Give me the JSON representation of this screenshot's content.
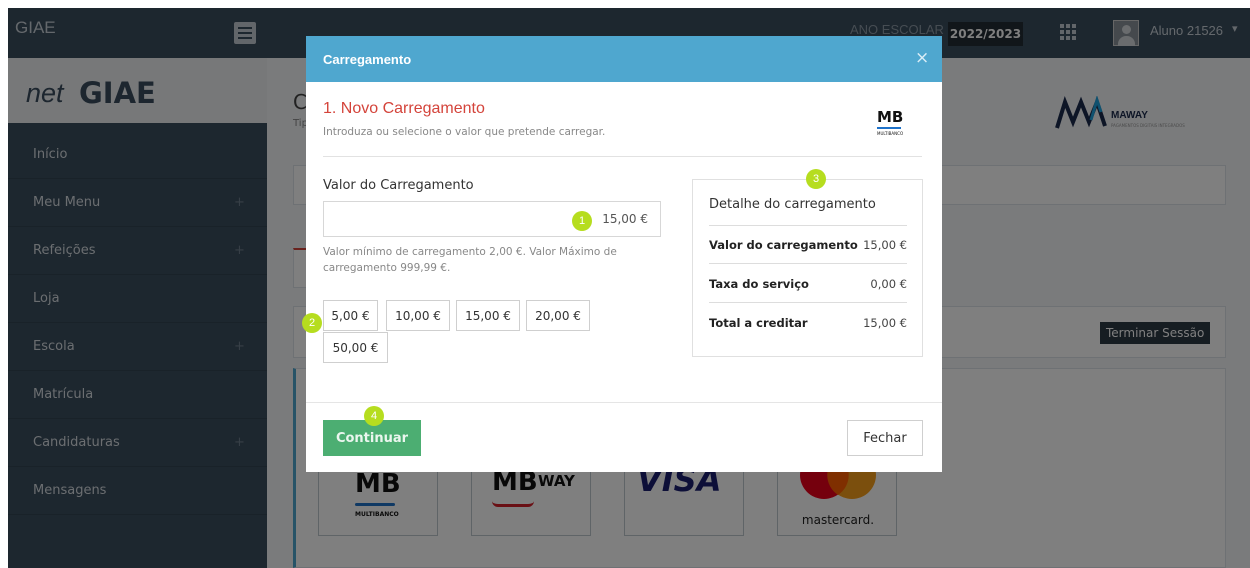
{
  "topbar": {
    "brand": "GIAE",
    "year_label": "ANO ESCOLAR",
    "year_value": "2022/2023",
    "user_name": "Aluno 21526",
    "caret": "▾"
  },
  "sidebar": {
    "logo_net": "net",
    "logo_giae": "GIAE",
    "items": [
      {
        "label": "Início",
        "expandable": false
      },
      {
        "label": "Meu Menu",
        "expandable": true
      },
      {
        "label": "Refeições",
        "expandable": true
      },
      {
        "label": "Loja",
        "expandable": false
      },
      {
        "label": "Escola",
        "expandable": true
      },
      {
        "label": "Matrícula",
        "expandable": false
      },
      {
        "label": "Candidaturas",
        "expandable": true
      },
      {
        "label": "Mensagens",
        "expandable": false
      }
    ],
    "plus": "+"
  },
  "background": {
    "title_fragment": "C",
    "sub_fragment": "Tip",
    "maway_brand": "MAWAY",
    "maway_tagline": "PAGAMENTOS DIGITAIS INTEGRADOS",
    "end_session": "Terminar Sessão",
    "mb_logo": "MB",
    "mb_sub": "MULTIBANCO",
    "mbway_logo": "MB",
    "mbway_word": "WAY",
    "visa_logo": "VISA",
    "mastercard_logo": "mastercard."
  },
  "modal": {
    "title": "Carregamento",
    "close": "×",
    "step_title": "1. Novo Carregamento",
    "step_subtitle": "Introduza ou selecione o valor que pretende carregar.",
    "mb_logo": "MB",
    "mb_sub": "MULTIBANCO",
    "value_label": "Valor do Carregamento",
    "value_current": "15,00 €",
    "value_help": "Valor mínimo de carregamento 2,00 €. Valor Máximo de carregamento 999,99 €.",
    "amounts": [
      "5,00 €",
      "10,00 €",
      "15,00 €",
      "20,00 €",
      "50,00 €"
    ],
    "detail": {
      "title": "Detalhe do carregamento",
      "rows": [
        {
          "label": "Valor do carregamento",
          "value": "15,00 €"
        },
        {
          "label": "Taxa do serviço",
          "value": "0,00 €"
        },
        {
          "label": "Total a creditar",
          "value": "15,00 €"
        }
      ]
    },
    "continue_label": "Continuar",
    "close_label": "Fechar"
  },
  "markers": [
    "1",
    "2",
    "3",
    "4"
  ],
  "colors": {
    "header": "#3b4e5e",
    "modal_header": "#4fa7cf",
    "step_title": "#d4443b",
    "continue": "#4cae72",
    "marker": "#b6dd1f"
  }
}
